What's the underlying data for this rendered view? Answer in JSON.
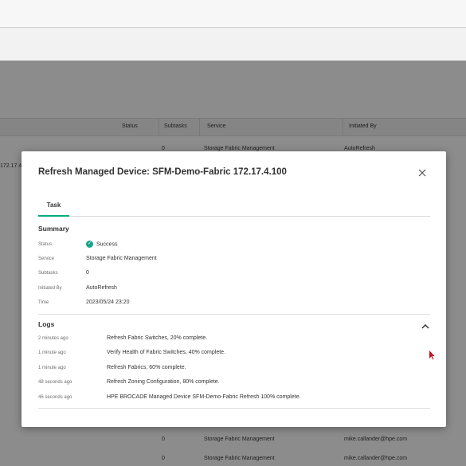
{
  "background": {
    "columns": {
      "status": "Status",
      "subtasks": "Subtasks",
      "service": "Service",
      "initiated_by": "Initiated By"
    },
    "side_text": "172.17.4.",
    "rows": [
      {
        "subtasks": "0",
        "service": "Storage Fabric Management",
        "initiated_by": "AutoRefresh"
      },
      {
        "subtasks": "0",
        "service": "Storage Fabric Management",
        "initiated_by": "mike.callander@hpe.com"
      },
      {
        "subtasks": "0",
        "service": "Storage Fabric Management",
        "initiated_by": "mike.callander@hpe.com"
      }
    ]
  },
  "modal": {
    "title": "Refresh Managed Device: SFM-Demo-Fabric 172.17.4.100",
    "close_icon": "close-icon",
    "tabs": [
      {
        "label": "Task",
        "active": true
      }
    ],
    "summary": {
      "heading": "Summary",
      "fields": [
        {
          "label": "Status",
          "value": "Success"
        },
        {
          "label": "Service",
          "value": "Storage Fabric Management"
        },
        {
          "label": "Subtasks",
          "value": "0"
        },
        {
          "label": "Initiated By",
          "value": "AutoRefresh"
        },
        {
          "label": "Time",
          "value": "2023/05/24 23:20"
        }
      ]
    },
    "logs": {
      "heading": "Logs",
      "entries": [
        {
          "time": "2 minutes ago",
          "message": "Refresh Fabric Switches, 20% complete."
        },
        {
          "time": "1 minute ago",
          "message": "Verify Health of Fabric Switches, 40% complete."
        },
        {
          "time": "1 minute ago",
          "message": "Refresh Fabrics, 60% complete."
        },
        {
          "time": "48 seconds ago",
          "message": "Refresh Zoning Configuration, 80% complete."
        },
        {
          "time": "46 seconds ago",
          "message": "HPE BROCADE Managed Device SFM-Demo-Fabric Refresh 100% complete."
        }
      ]
    }
  },
  "colors": {
    "accent": "#01a982",
    "success": "#17a589",
    "cursor": "#c1121f"
  }
}
